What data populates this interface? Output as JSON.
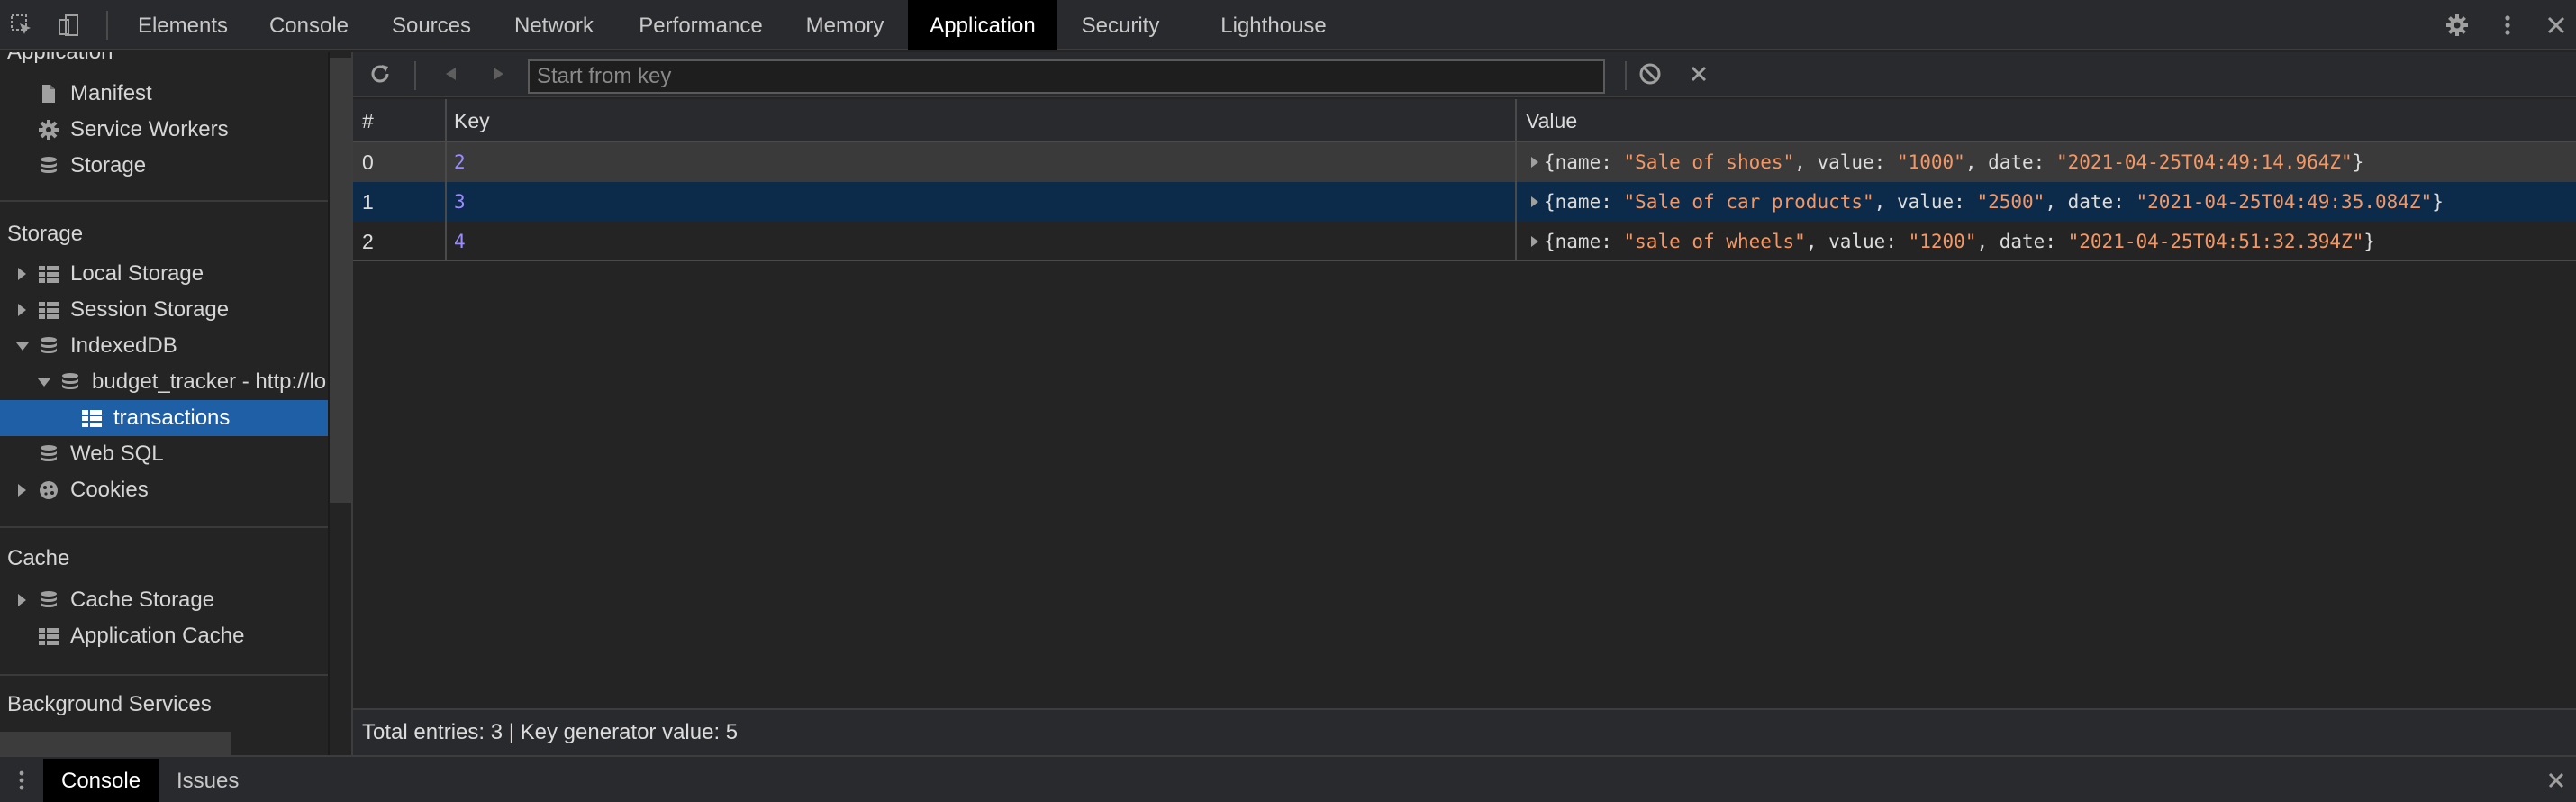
{
  "toolbar": {
    "tabs": [
      {
        "label": "Elements"
      },
      {
        "label": "Console"
      },
      {
        "label": "Sources"
      },
      {
        "label": "Network"
      },
      {
        "label": "Performance"
      },
      {
        "label": "Memory"
      },
      {
        "label": "Application",
        "active": true
      },
      {
        "label": "Security"
      },
      {
        "label": "Lighthouse"
      }
    ],
    "icons": [
      "inspect-element-icon",
      "device-toolbar-icon",
      "settings-gear-icon",
      "more-options-icon",
      "close-icon"
    ]
  },
  "sidebar": {
    "application_header": "Application",
    "application_items": [
      {
        "label": "Manifest",
        "icon": "document-icon"
      },
      {
        "label": "Service Workers",
        "icon": "gear-icon"
      },
      {
        "label": "Storage",
        "icon": "database-icon"
      }
    ],
    "storage_header": "Storage",
    "storage_items": [
      {
        "label": "Local Storage",
        "icon": "grid-icon"
      },
      {
        "label": "Session Storage",
        "icon": "grid-icon"
      },
      {
        "label": "IndexedDB",
        "icon": "database-icon"
      },
      {
        "label": "budget_tracker - http://lo",
        "icon": "database-icon"
      },
      {
        "label": "transactions",
        "icon": "grid-icon",
        "selected": true
      },
      {
        "label": "Web SQL",
        "icon": "database-icon"
      },
      {
        "label": "Cookies",
        "icon": "cookie-icon"
      }
    ],
    "cache_header": "Cache",
    "cache_items": [
      {
        "label": "Cache Storage",
        "icon": "database-icon"
      },
      {
        "label": "Application Cache",
        "icon": "grid-icon"
      }
    ],
    "background_header": "Background Services"
  },
  "main": {
    "search_placeholder": "Start from key",
    "columns": [
      "#",
      "Key",
      "Value"
    ],
    "rows": [
      {
        "num": "0",
        "key": "2",
        "name": "\"Sale of shoes\"",
        "value": "\"1000\"",
        "date": "\"2021-04-25T04:49:14.964Z\""
      },
      {
        "num": "1",
        "key": "3",
        "name": "\"Sale of car products\"",
        "value": "\"2500\"",
        "date": "\"2021-04-25T04:49:35.084Z\""
      },
      {
        "num": "2",
        "key": "4",
        "name": "\"sale of wheels\"",
        "value": "\"1200\"",
        "date": "\"2021-04-25T04:51:32.394Z\""
      }
    ],
    "value_tokens": {
      "open": "{name: ",
      "sep_value": ", value: ",
      "sep_date": ", date: ",
      "close": "}"
    },
    "status": "Total entries: 3 | Key generator value: 5"
  },
  "drawer": {
    "tabs": [
      {
        "label": "Console",
        "active": true
      },
      {
        "label": "Issues"
      }
    ]
  },
  "colors": {
    "accent_selected": "#1f5fa6",
    "row_selected": "#0c2a4a",
    "string": "#f29766",
    "key": "#9a8cff"
  }
}
